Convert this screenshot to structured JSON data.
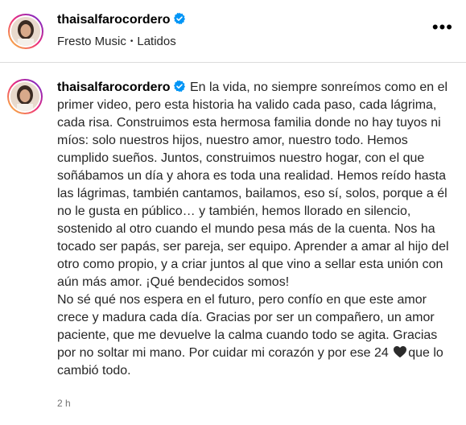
{
  "header": {
    "username": "thaisalfarocordero",
    "verified_icon": "verified-badge-icon",
    "audio_artist": "Fresto Music",
    "audio_track": "Latidos",
    "separator": "•",
    "more_label": "•••"
  },
  "caption": {
    "username": "thaisalfarocordero",
    "paragraph1": "En la vida, no siempre sonreímos como en el primer video, pero esta historia ha valido cada paso, cada lágrima, cada risa. Construimos esta hermosa familia donde no hay tuyos ni míos: solo nuestros hijos, nuestro amor, nuestro todo. Hemos cumplido sueños. Juntos, construimos nuestro hogar, con el que soñábamos un día y ahora es toda una realidad. Hemos reído hasta las lágrimas, también cantamos, bailamos, eso sí, solos, porque a él no le gusta en público… y también, hemos llorado en silencio, sostenido al otro cuando el mundo pesa más de la cuenta. Nos ha tocado ser papás, ser pareja, ser equipo. Aprender a amar al hijo del otro como propio, y a criar juntos al que vino a sellar esta unión con aún más amor. ¡Qué bendecidos somos!",
    "paragraph2_start": "No sé qué nos espera en el futuro, pero confío en que este amor crece y madura cada día. Gracias por ser un compañero, un amor paciente, que me devuelve la calma cuando todo se agita. Gracias por no soltar mi mano. Por cuidar mi corazón y por ese 24",
    "heart_icon": "black-heart-icon",
    "paragraph2_end": "que lo cambió todo."
  },
  "timestamp": "2 h",
  "colors": {
    "verified_blue": "#0095f6",
    "text": "#262626",
    "muted": "#737373"
  }
}
